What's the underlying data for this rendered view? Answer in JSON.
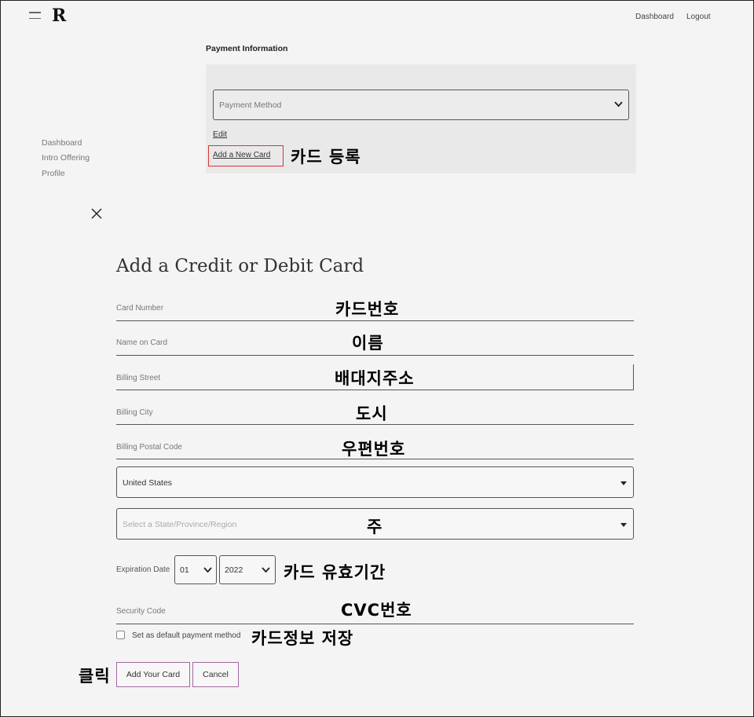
{
  "header": {
    "logo": "R",
    "nav": [
      "Dashboard",
      "Logout"
    ]
  },
  "sidebar": {
    "items": [
      "Dashboard",
      "Intro Offering",
      "Profile"
    ]
  },
  "payment": {
    "title": "Payment Information",
    "method_placeholder": "Payment Method",
    "edit_label": "Edit",
    "add_card_label": "Add a New Card",
    "add_card_note": "카드 등록"
  },
  "modal": {
    "title": "Add a Credit or Debit Card",
    "fields": [
      {
        "label": "Card Number",
        "note": "카드번호"
      },
      {
        "label": "Name on Card",
        "note": "이름"
      },
      {
        "label": "Billing Street",
        "note": "배대지주소"
      },
      {
        "label": "Billing City",
        "note": "도시"
      },
      {
        "label": "Billing Postal Code",
        "note": "우편번호"
      }
    ],
    "country": "United States",
    "state_placeholder": "Select a State/Province/Region",
    "state_note": "주",
    "expiration_label": "Expiration Date",
    "exp_month": "01",
    "exp_year": "2022",
    "expiration_note": "카드 유효기간",
    "security_label": "Security Code",
    "security_note": "CVC번호",
    "default_label": "Set as default payment method",
    "default_note": "카드정보 저장",
    "click_note": "클릭",
    "add_button": "Add Your Card",
    "cancel_button": "Cancel"
  },
  "colors": {
    "highlight_red": "#dd3333",
    "button_border": "#a06aa0"
  }
}
